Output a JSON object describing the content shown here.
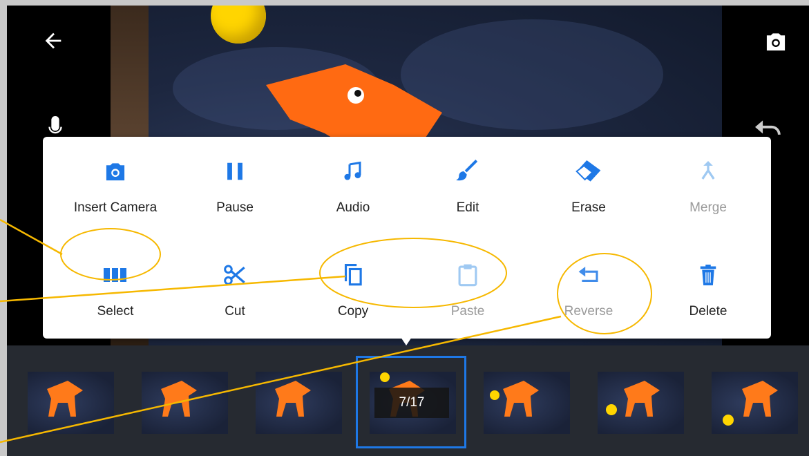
{
  "toolbar": {
    "back": "back-arrow-icon",
    "camera": "camera-icon",
    "mic": "microphone-icon",
    "undo": "undo-icon"
  },
  "menu": {
    "row1": [
      {
        "label": "Insert Camera",
        "icon": "camera-icon",
        "enabled": true
      },
      {
        "label": "Pause",
        "icon": "pause-icon",
        "enabled": true
      },
      {
        "label": "Audio",
        "icon": "music-note-icon",
        "enabled": true
      },
      {
        "label": "Edit",
        "icon": "brush-icon",
        "enabled": true
      },
      {
        "label": "Erase",
        "icon": "eraser-icon",
        "enabled": true
      },
      {
        "label": "Merge",
        "icon": "merge-icon",
        "enabled": false
      }
    ],
    "row2": [
      {
        "label": "Select",
        "icon": "select-frames-icon",
        "enabled": true
      },
      {
        "label": "Cut",
        "icon": "scissors-icon",
        "enabled": true
      },
      {
        "label": "Copy",
        "icon": "copy-icon",
        "enabled": true
      },
      {
        "label": "Paste",
        "icon": "paste-icon",
        "enabled": false
      },
      {
        "label": "Reverse",
        "icon": "reverse-icon",
        "enabled": false
      },
      {
        "label": "Delete",
        "icon": "trash-icon",
        "enabled": true
      }
    ]
  },
  "timeline": {
    "frame_counter": "7/17",
    "current_frame": 7,
    "total_frames": 17,
    "visible_thumbnails": 7
  },
  "colors": {
    "accent": "#1e78e6",
    "annotation": "#f6b800",
    "disabled": "#9fc9f2"
  }
}
